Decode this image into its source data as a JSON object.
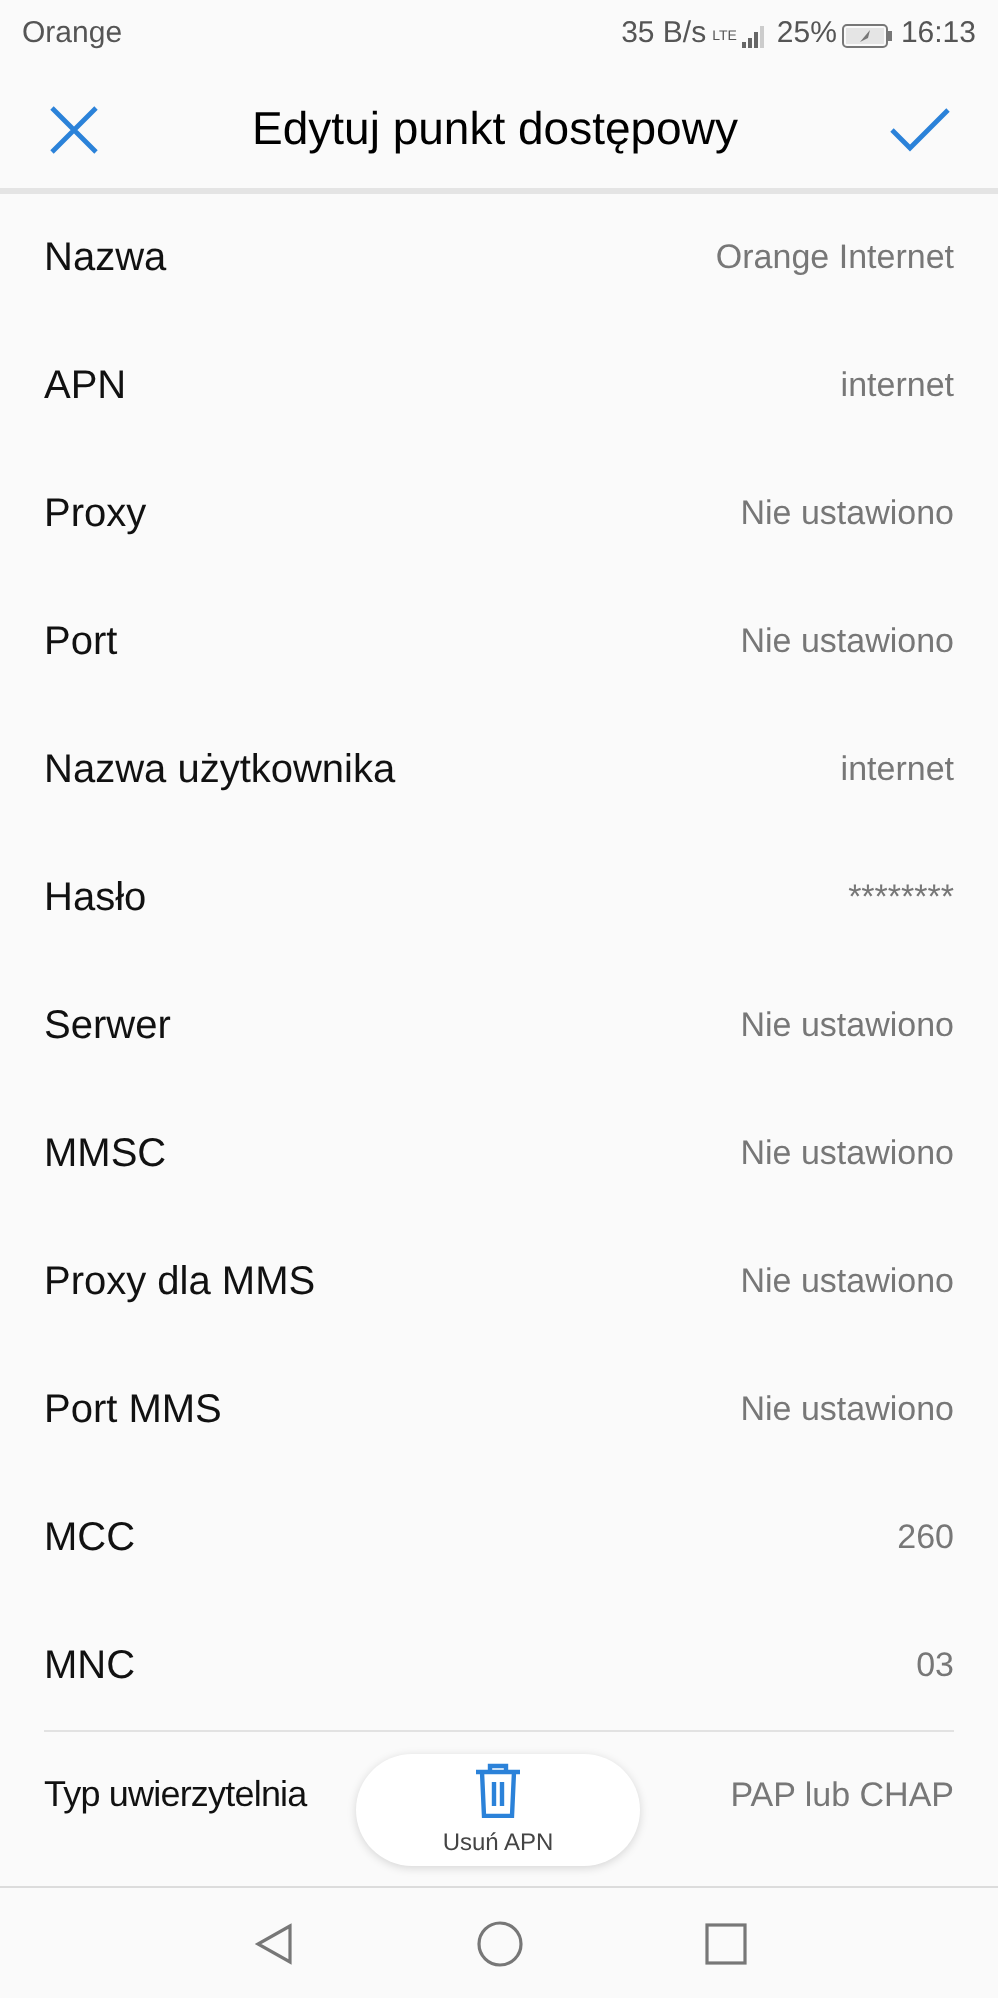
{
  "status_bar": {
    "carrier": "Orange",
    "speed": "35 B/s",
    "network": "LTE",
    "battery": "25%",
    "time": "16:13"
  },
  "toolbar": {
    "title": "Edytuj punkt dostępowy"
  },
  "fields": [
    {
      "label": "Nazwa",
      "value": "Orange Internet"
    },
    {
      "label": "APN",
      "value": "internet"
    },
    {
      "label": "Proxy",
      "value": "Nie ustawiono"
    },
    {
      "label": "Port",
      "value": "Nie ustawiono"
    },
    {
      "label": "Nazwa użytkownika",
      "value": "internet"
    },
    {
      "label": "Hasło",
      "value": "********"
    },
    {
      "label": "Serwer",
      "value": "Nie ustawiono"
    },
    {
      "label": "MMSC",
      "value": "Nie ustawiono"
    },
    {
      "label": "Proxy dla MMS",
      "value": "Nie ustawiono"
    },
    {
      "label": "Port MMS",
      "value": "Nie ustawiono"
    },
    {
      "label": "MCC",
      "value": "260"
    },
    {
      "label": "MNC",
      "value": "03"
    },
    {
      "label": "Typ uwierzytelnia",
      "value": "PAP lub CHAP"
    }
  ],
  "floating_action": {
    "label": "Usuń APN"
  }
}
